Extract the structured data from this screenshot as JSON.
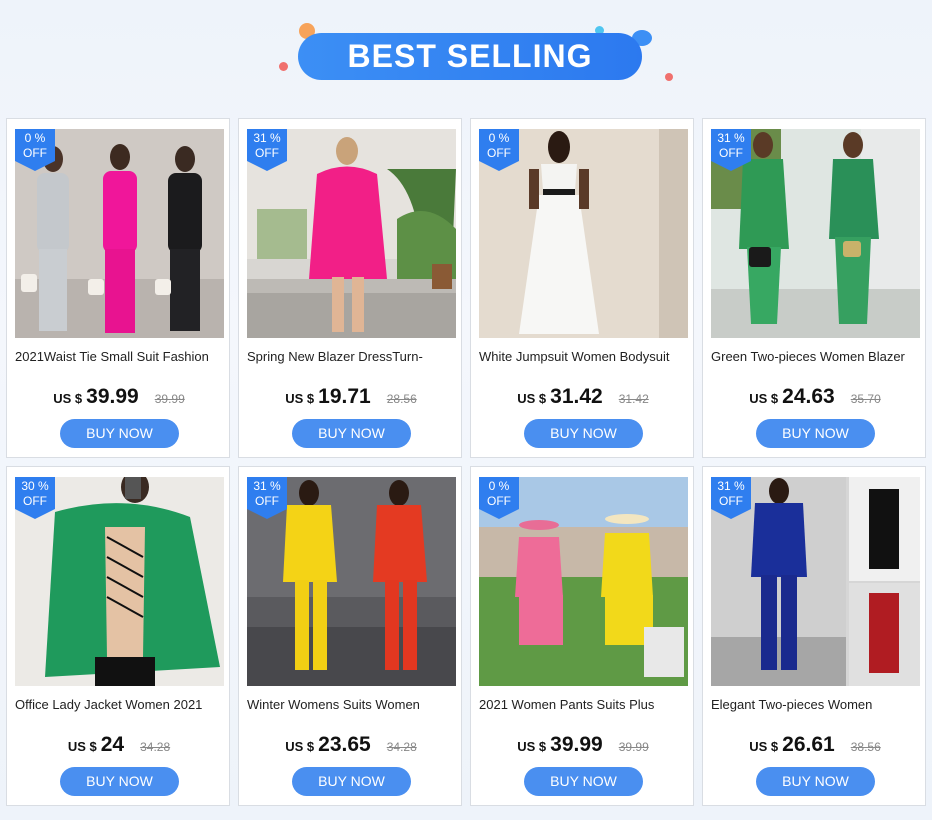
{
  "header": {
    "title": "BEST SELLING"
  },
  "colors": {
    "accent": "#4a8ff0",
    "banner": "#2f7eef",
    "badge": "#2f7eef"
  },
  "products": [
    {
      "badge_pct": "0  %",
      "badge_off": "OFF",
      "title": "2021Waist Tie Small Suit Fashion",
      "currency": "US $",
      "price": "39.99",
      "old_price": "39.99",
      "button": "BUY NOW"
    },
    {
      "badge_pct": "31  %",
      "badge_off": "OFF",
      "title": "Spring New Blazer DressTurn-",
      "currency": "US $",
      "price": "19.71",
      "old_price": "28.56",
      "button": "BUY NOW"
    },
    {
      "badge_pct": "0  %",
      "badge_off": "OFF",
      "title": "White Jumpsuit Women Bodysuit",
      "currency": "US $",
      "price": "31.42",
      "old_price": "31.42",
      "button": "BUY NOW"
    },
    {
      "badge_pct": "31  %",
      "badge_off": "OFF",
      "title": "Green Two-pieces Women Blazer",
      "currency": "US $",
      "price": "24.63",
      "old_price": "35.70",
      "button": "BUY NOW"
    },
    {
      "badge_pct": "30  %",
      "badge_off": "OFF",
      "title": "Office Lady Jacket Women 2021",
      "currency": "US $",
      "price": "24",
      "old_price": "34.28",
      "button": "BUY NOW"
    },
    {
      "badge_pct": "31  %",
      "badge_off": "OFF",
      "title": "Winter Womens Suits Women",
      "currency": "US $",
      "price": "23.65",
      "old_price": "34.28",
      "button": "BUY NOW"
    },
    {
      "badge_pct": "0  %",
      "badge_off": "OFF",
      "title": "2021 Women Pants Suits Plus",
      "currency": "US $",
      "price": "39.99",
      "old_price": "39.99",
      "button": "BUY NOW"
    },
    {
      "badge_pct": "31  %",
      "badge_off": "OFF",
      "title": "Elegant Two-pieces Women",
      "currency": "US $",
      "price": "26.61",
      "old_price": "38.56",
      "button": "BUY NOW"
    }
  ]
}
